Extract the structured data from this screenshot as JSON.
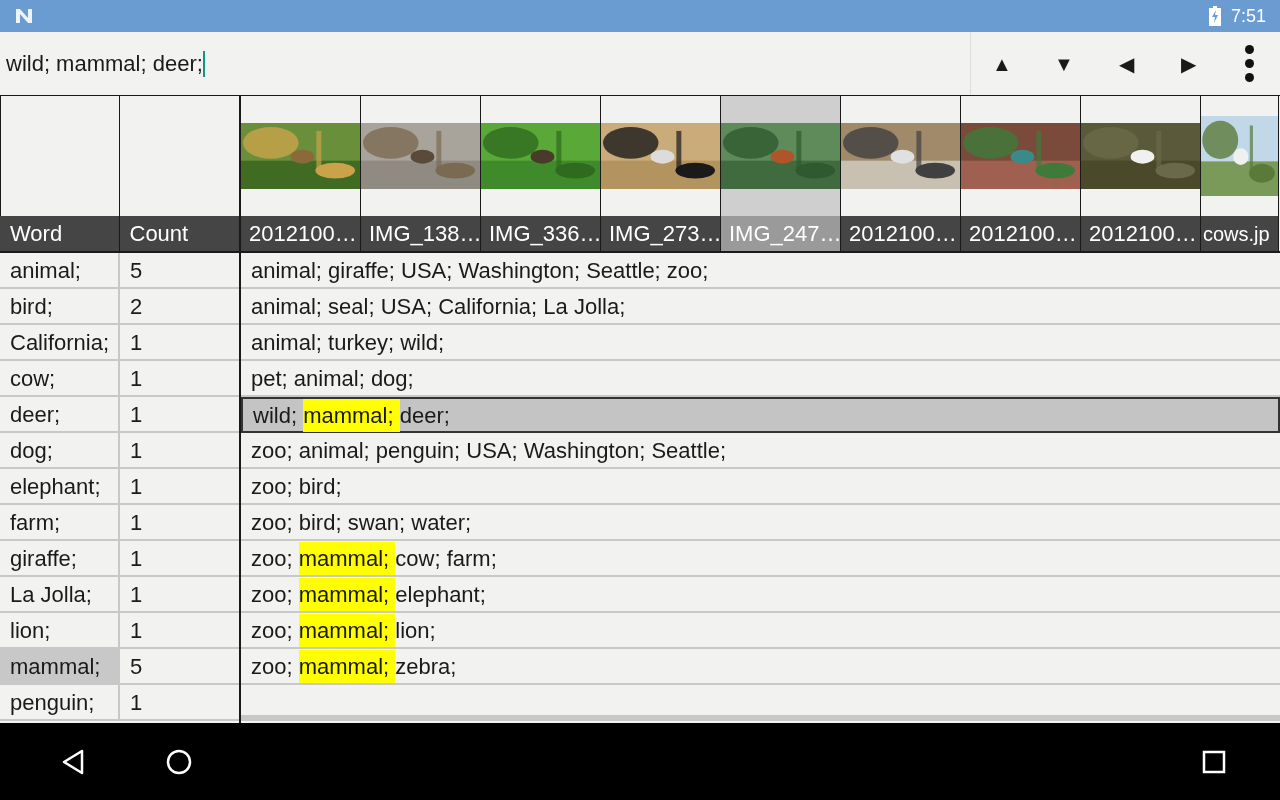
{
  "status_bar": {
    "time": "7:51"
  },
  "search": {
    "value": "wild; mammal; deer;"
  },
  "toolbar": [
    "▲",
    "▼",
    "◀",
    "▶"
  ],
  "word_table": {
    "columns": [
      "Word",
      "Count"
    ],
    "rows": [
      {
        "word": "animal;",
        "count": "5",
        "selected": false
      },
      {
        "word": "bird;",
        "count": "2",
        "selected": false
      },
      {
        "word": "California;",
        "count": "1",
        "selected": false
      },
      {
        "word": "cow;",
        "count": "1",
        "selected": false
      },
      {
        "word": "deer;",
        "count": "1",
        "selected": false
      },
      {
        "word": "dog;",
        "count": "1",
        "selected": false
      },
      {
        "word": "elephant;",
        "count": "1",
        "selected": false
      },
      {
        "word": "farm;",
        "count": "1",
        "selected": false
      },
      {
        "word": "giraffe;",
        "count": "1",
        "selected": false
      },
      {
        "word": "La Jolla;",
        "count": "1",
        "selected": false
      },
      {
        "word": "lion;",
        "count": "1",
        "selected": false
      },
      {
        "word": "mammal;",
        "count": "5",
        "selected": true
      },
      {
        "word": "penguin;",
        "count": "1",
        "selected": false
      }
    ]
  },
  "thumbnails": [
    {
      "label": "2012100…",
      "selected": false
    },
    {
      "label": "IMG_138…",
      "selected": false
    },
    {
      "label": "IMG_336…",
      "selected": false
    },
    {
      "label": "IMG_273…",
      "selected": false
    },
    {
      "label": "IMG_247…",
      "selected": true
    },
    {
      "label": "2012100…",
      "selected": false
    },
    {
      "label": "2012100…",
      "selected": false
    },
    {
      "label": "2012100…",
      "selected": false
    },
    {
      "label": "cows.jp",
      "selected": false
    }
  ],
  "captions": [
    {
      "selected": false,
      "tags": [
        {
          "text": "animal;",
          "highlighted": false
        },
        {
          "text": "giraffe;",
          "highlighted": false
        },
        {
          "text": "USA;",
          "highlighted": false
        },
        {
          "text": "Washington;",
          "highlighted": false
        },
        {
          "text": "Seattle;",
          "highlighted": false
        },
        {
          "text": "zoo;",
          "highlighted": false
        }
      ]
    },
    {
      "selected": false,
      "tags": [
        {
          "text": "animal;",
          "highlighted": false
        },
        {
          "text": "seal;",
          "highlighted": false
        },
        {
          "text": "USA;",
          "highlighted": false
        },
        {
          "text": "California;",
          "highlighted": false
        },
        {
          "text": "La Jolla;",
          "highlighted": false
        }
      ]
    },
    {
      "selected": false,
      "tags": [
        {
          "text": "animal;",
          "highlighted": false
        },
        {
          "text": "turkey;",
          "highlighted": false
        },
        {
          "text": "wild;",
          "highlighted": false
        }
      ]
    },
    {
      "selected": false,
      "tags": [
        {
          "text": "pet;",
          "highlighted": false
        },
        {
          "text": "animal;",
          "highlighted": false
        },
        {
          "text": "dog;",
          "highlighted": false
        }
      ]
    },
    {
      "selected": true,
      "tags": [
        {
          "text": "wild;",
          "highlighted": false
        },
        {
          "text": "mammal;",
          "highlighted": true
        },
        {
          "text": "deer;",
          "highlighted": false
        }
      ]
    },
    {
      "selected": false,
      "tags": [
        {
          "text": "zoo;",
          "highlighted": false
        },
        {
          "text": "animal;",
          "highlighted": false
        },
        {
          "text": "penguin;",
          "highlighted": false
        },
        {
          "text": "USA;",
          "highlighted": false
        },
        {
          "text": "Washington;",
          "highlighted": false
        },
        {
          "text": "Seattle;",
          "highlighted": false
        }
      ]
    },
    {
      "selected": false,
      "tags": [
        {
          "text": "zoo;",
          "highlighted": false
        },
        {
          "text": "bird;",
          "highlighted": false
        }
      ]
    },
    {
      "selected": false,
      "tags": [
        {
          "text": "zoo;",
          "highlighted": false
        },
        {
          "text": "bird;",
          "highlighted": false
        },
        {
          "text": "swan;",
          "highlighted": false
        },
        {
          "text": "water;",
          "highlighted": false
        }
      ]
    },
    {
      "selected": false,
      "tags": [
        {
          "text": "zoo;",
          "highlighted": false
        },
        {
          "text": "mammal;",
          "highlighted": true
        },
        {
          "text": "cow;",
          "highlighted": false
        },
        {
          "text": "farm;",
          "highlighted": false
        }
      ]
    },
    {
      "selected": false,
      "tags": [
        {
          "text": "zoo;",
          "highlighted": false
        },
        {
          "text": "mammal;",
          "highlighted": true
        },
        {
          "text": "elephant;",
          "highlighted": false
        }
      ]
    },
    {
      "selected": false,
      "tags": [
        {
          "text": "zoo;",
          "highlighted": false
        },
        {
          "text": "mammal;",
          "highlighted": true
        },
        {
          "text": "lion;",
          "highlighted": false
        }
      ]
    },
    {
      "selected": false,
      "tags": [
        {
          "text": "zoo;",
          "highlighted": false
        },
        {
          "text": "mammal;",
          "highlighted": true
        },
        {
          "text": "zebra;",
          "highlighted": false
        }
      ]
    }
  ]
}
